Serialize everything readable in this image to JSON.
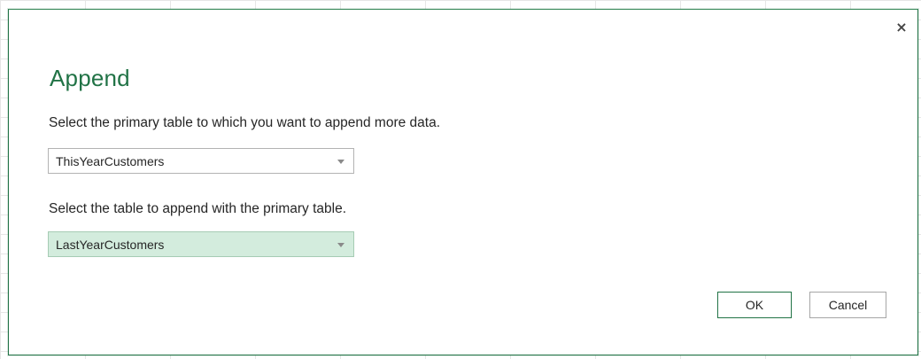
{
  "dialog": {
    "close_glyph": "×",
    "title": "Append",
    "primary_prompt": "Select the primary table to which you want to append more data.",
    "primary_table": {
      "selected": "ThisYearCustomers"
    },
    "append_prompt": "Select the table to append with the primary table.",
    "append_table": {
      "selected": "LastYearCustomers"
    },
    "ok_label": "OK",
    "cancel_label": "Cancel"
  },
  "colors": {
    "accent": "#217346",
    "selected_field_bg": "#d3ecdd"
  },
  "icons": {
    "close": "close-icon",
    "dropdown": "chevron-down-icon"
  }
}
